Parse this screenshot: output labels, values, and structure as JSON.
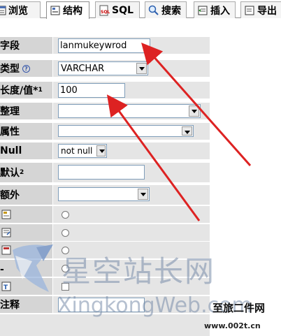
{
  "tabs": [
    {
      "label": "浏览",
      "icon": "browse-icon",
      "active": false
    },
    {
      "label": "结构",
      "icon": "structure-icon",
      "active": true
    },
    {
      "label": "SQL",
      "icon": "sql-icon",
      "active": false
    },
    {
      "label": "搜索",
      "icon": "search-icon",
      "active": false
    },
    {
      "label": "插入",
      "icon": "insert-icon",
      "active": false
    },
    {
      "label": "导出",
      "icon": "export-icon",
      "active": false
    }
  ],
  "form": {
    "field_label": "字段",
    "field_value": "lanmukeywrod",
    "type_label": "类型",
    "type_value": "VARCHAR",
    "length_label": "长度/值*",
    "length_sup": "1",
    "length_value": "100",
    "collation_label": "整理",
    "collation_value": "",
    "attributes_label": "属性",
    "attributes_value": "",
    "null_label": "Null",
    "null_value": "not null",
    "default_label": "默认",
    "default_sup": "2",
    "default_value": "",
    "extra_label": "额外",
    "extra_value": "",
    "comment_label": "注释"
  },
  "watermark": {
    "cn_text": "星空站长网",
    "en_text": "XingkongWeb.com",
    "signature": "至旅二件网",
    "url": "www.002t.cn"
  },
  "colors": {
    "label_bg": "#d5d5d5",
    "value_bg": "#e5e5e5",
    "arrow": "#dd2222"
  }
}
